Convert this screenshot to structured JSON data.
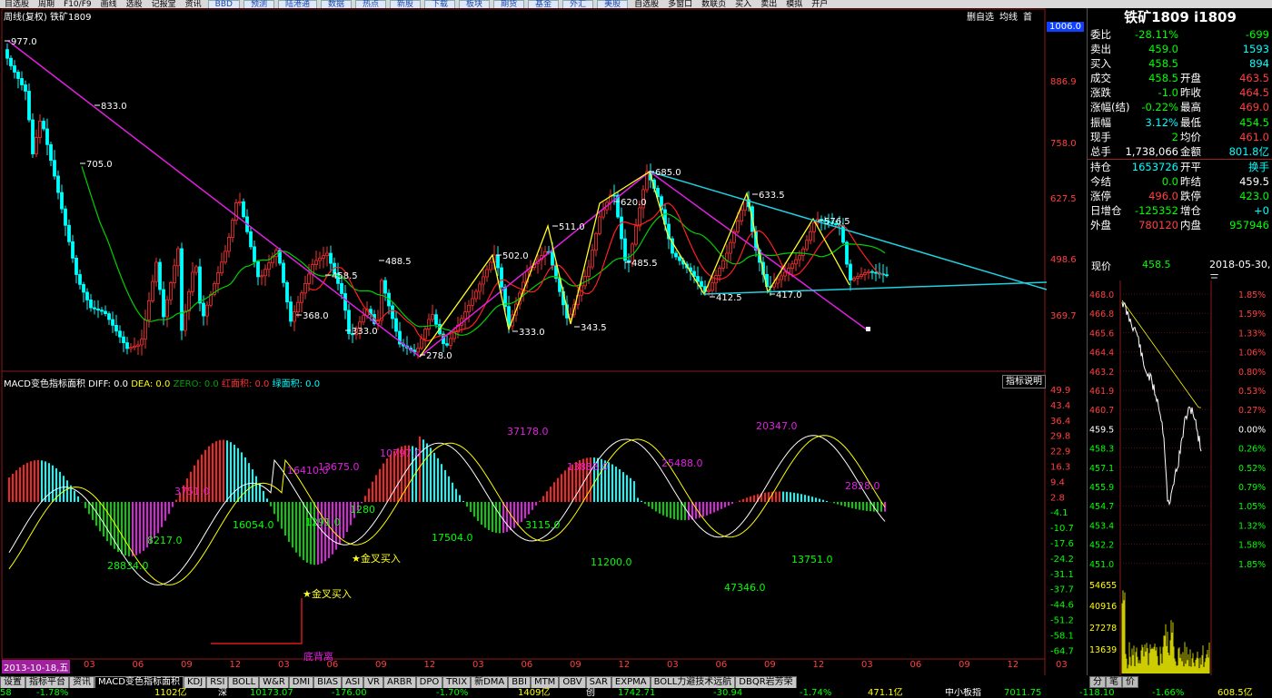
{
  "menu": {
    "items": [
      "目选股",
      "周期",
      "F10/F9",
      "画线",
      "选股",
      "记报堂",
      "资讯"
    ],
    "buttons": [
      "BBD",
      "预测",
      "陆港通",
      "数据",
      "热点",
      "新股"
    ],
    "buttons2": [
      "下载",
      "板块",
      "期货",
      "基金",
      "外汇",
      "美股"
    ],
    "right_items": [
      "自选股",
      "多窗口",
      "数联页",
      "买入",
      "卖出",
      "模拟",
      "开户"
    ]
  },
  "chart": {
    "title": "周线(复权) 铁矿1809",
    "top_buttons": [
      "删自选",
      "均线",
      "首"
    ],
    "price_ticks": [
      "1006.0",
      "886.9",
      "758.0",
      "627.5",
      "498.6",
      "369.7"
    ],
    "highlow_labels": [
      "977.0",
      "833.0",
      "705.0",
      "458.5",
      "488.5",
      "368.0",
      "333.0",
      "278.0",
      "502.0",
      "333.0",
      "511.0",
      "343.5",
      "620.0",
      "685.0",
      "485.5",
      "633.5",
      "412.5",
      "576.5",
      "417.0"
    ]
  },
  "macd": {
    "header_name": "MACD变色指标面积",
    "diff": "DIFF: 0.0",
    "dea": "DEA: 0.0",
    "zero": "ZERO: 0.0",
    "red_area": "红面积: 0.0",
    "green_area": "绿面积: 0.0",
    "help_button": "指标说明",
    "ticks": [
      "49.9",
      "43.4",
      "36.4",
      "29.8",
      "22.9",
      "16.3",
      "9.4",
      "2.8",
      "-4.1",
      "-10.7",
      "-17.6",
      "-24.2",
      "-31.1",
      "-37.7",
      "-44.6",
      "-51.2",
      "-58.1",
      "-64.7"
    ],
    "area_labels_magenta": [
      "3751.0",
      "16410.0",
      "13675.0",
      "10797.0",
      "37178.0",
      "13888.0",
      "25488.0",
      "20347.0",
      "2828.0"
    ],
    "area_labels_green": [
      "28834.0",
      "8217.0",
      "16054.0",
      "1291.0",
      "1280",
      "17504.0",
      "3115.0",
      "11200.0",
      "47346.0",
      "13751.0"
    ],
    "signals": [
      "★金叉买入",
      "★金叉买入"
    ],
    "divergence": "底背离"
  },
  "xaxis": {
    "start": "2013-10-18,五",
    "labels": [
      "03",
      "06",
      "09",
      "12",
      "03",
      "06",
      "09",
      "12",
      "03",
      "06",
      "09",
      "12",
      "03",
      "06",
      "09",
      "12",
      "03",
      "06",
      "09",
      "12",
      "03"
    ]
  },
  "tabs": [
    "设置",
    "指标平台",
    "资讯",
    "MACD变色指标面积",
    "KDJ",
    "RSI",
    "BOLL",
    "W&R",
    "DMI",
    "BIAS",
    "ASI",
    "VR",
    "ARBR",
    "DPO",
    "TRIX",
    "新DMA",
    "BBI",
    "MTM",
    "OBV",
    "SAR",
    "EXPMA",
    "BOLL力避技术远航",
    "DBQR岩芳荣"
  ],
  "status": {
    "s1": "58",
    "s2": "-1.78%",
    "s3": "1102亿",
    "s4": "深",
    "s5": "10173.07",
    "s6": "-176.00",
    "s7": "-1.70%",
    "s8": "1409亿",
    "s9": "创",
    "s10": "1742.71",
    "s11": "-30.94",
    "s12": "-1.74%",
    "s13": "471.1亿",
    "s14": "中小板指",
    "s15": "7011.75",
    "s16": "-118.10",
    "s17": "-1.66%",
    "s18": "608.5亿"
  },
  "side": {
    "title": "铁矿1809 i1809",
    "rows": [
      {
        "l": "委比",
        "v": "-28.11%",
        "c": "#00ff00",
        "l2": "",
        "v2": "-699",
        "c2": "#00ff00"
      },
      {
        "l": "卖出",
        "v": "459.0",
        "c": "#00ff00",
        "l2": "",
        "v2": "1593",
        "c2": "#00ffff"
      },
      {
        "l": "买入",
        "v": "458.5",
        "c": "#00ff00",
        "l2": "",
        "v2": "894",
        "c2": "#00ffff"
      },
      {
        "l": "成交",
        "v": "458.5",
        "c": "#00ff00",
        "l2": "开盘",
        "v2": "463.5",
        "c2": "#ff4040"
      },
      {
        "l": "涨跌",
        "v": "-1.0",
        "c": "#00ff00",
        "l2": "昨收",
        "v2": "464.5",
        "c2": "#ff4040"
      },
      {
        "l": "涨幅(结)",
        "v": "-0.22%",
        "c": "#00ff00",
        "l2": "最高",
        "v2": "469.0",
        "c2": "#ff4040"
      },
      {
        "l": "振幅",
        "v": "3.12%",
        "c": "#00ffff",
        "l2": "最低",
        "v2": "454.5",
        "c2": "#00ff00"
      },
      {
        "l": "现手",
        "v": "2",
        "c": "#00ff00",
        "l2": "均价",
        "v2": "461.0",
        "c2": "#ff4040"
      },
      {
        "l": "总手",
        "v": "1,738,066",
        "c": "#ffffff",
        "l2": "金额",
        "v2": "801.8亿",
        "c2": "#00ffff"
      },
      {
        "l": "持仓",
        "v": "1653726",
        "c": "#00ffff",
        "l2": "开平",
        "v2": "换手",
        "c2": "#00ffff"
      },
      {
        "l": "今结",
        "v": "0.0",
        "c": "#00ff00",
        "l2": "昨结",
        "v2": "459.5",
        "c2": "#ffffff"
      },
      {
        "l": "涨停",
        "v": "496.0",
        "c": "#ff4040",
        "l2": "跌停",
        "v2": "423.0",
        "c2": "#00ff00"
      },
      {
        "l": "日增仓",
        "v": "-125352",
        "c": "#00ff00",
        "l2": "增仓",
        "v2": "+0",
        "c2": "#00ffff"
      },
      {
        "l": "外盘",
        "v": "780120",
        "c": "#ff4040",
        "l2": "内盘",
        "v2": "957946",
        "c2": "#00ff00"
      }
    ],
    "price_label": "现价",
    "price_value": "458.5",
    "date": "2018-05-30,三",
    "mini_left": [
      "468.0",
      "466.8",
      "465.6",
      "464.4",
      "463.2",
      "461.9",
      "460.7",
      "459.5",
      "458.3",
      "457.1",
      "455.9",
      "454.7",
      "453.4",
      "452.2",
      "451.0"
    ],
    "mini_right": [
      "1.85%",
      "1.59%",
      "1.33%",
      "1.06%",
      "0.80%",
      "0.53%",
      "0.27%",
      "0.00%",
      "0.26%",
      "0.52%",
      "0.79%",
      "1.05%",
      "1.32%",
      "1.58%",
      "1.85%"
    ],
    "vol_labels": [
      "54655",
      "40916",
      "27278",
      "13639"
    ],
    "tabs": [
      "分",
      "笔",
      "价"
    ]
  }
}
